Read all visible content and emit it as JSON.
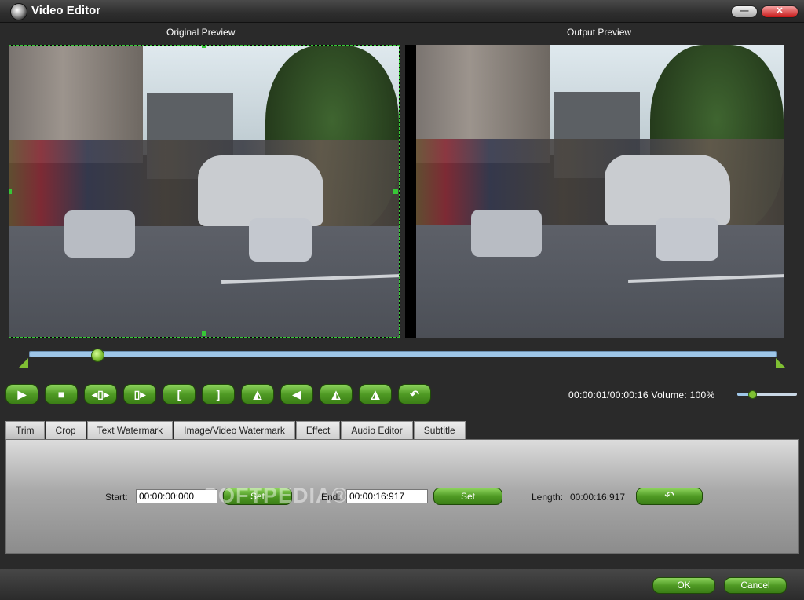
{
  "window": {
    "title": "Video Editor",
    "icon": "camera-icon"
  },
  "previews": {
    "original_label": "Original Preview",
    "output_label": "Output Preview"
  },
  "timeline": {
    "position_fraction": 0.09
  },
  "controls": {
    "buttons": [
      {
        "name": "play-button",
        "icon": "play-icon",
        "glyph": "▶"
      },
      {
        "name": "stop-button",
        "icon": "stop-icon",
        "glyph": "■"
      },
      {
        "name": "prev-frame-button",
        "icon": "previous-frame-icon",
        "glyph": "◂▯▸"
      },
      {
        "name": "next-frame-button",
        "icon": "next-frame-icon",
        "glyph": "▯▸"
      },
      {
        "name": "mark-in-button",
        "icon": "mark-in-bracket-icon",
        "glyph": "["
      },
      {
        "name": "mark-out-button",
        "icon": "mark-out-bracket-icon",
        "glyph": "]"
      },
      {
        "name": "flip-horizontal-button",
        "icon": "flip-horizontal-icon",
        "glyph": "◭"
      },
      {
        "name": "flip-vertical-button",
        "icon": "flip-vertical-icon",
        "glyph": "◀"
      },
      {
        "name": "rotate-left-button",
        "icon": "rotate-left-icon",
        "glyph": "◭"
      },
      {
        "name": "rotate-right-button",
        "icon": "rotate-right-icon",
        "glyph": "◮"
      },
      {
        "name": "undo-button",
        "icon": "undo-icon",
        "glyph": "↶"
      }
    ],
    "time_readout": "00:00:01/00:00:16",
    "volume_label": "Volume:",
    "volume_value": "100%",
    "volume_fraction": 0.25
  },
  "tabs": [
    {
      "label": "Trim",
      "active": true
    },
    {
      "label": "Crop",
      "active": false
    },
    {
      "label": "Text Watermark",
      "active": false
    },
    {
      "label": "Image/Video Watermark",
      "active": false
    },
    {
      "label": "Effect",
      "active": false
    },
    {
      "label": "Audio Editor",
      "active": false
    },
    {
      "label": "Subtitle",
      "active": false
    }
  ],
  "trim": {
    "start_label": "Start:",
    "start_value": "00:00:00:000",
    "end_label": "End:",
    "end_value": "00:00:16:917",
    "set_label": "Set",
    "length_label": "Length:",
    "length_value": "00:00:16:917",
    "reset_icon": "reset-icon"
  },
  "watermark_text": "SOFTPEDIA®",
  "dialog": {
    "ok_label": "OK",
    "cancel_label": "Cancel"
  },
  "colors": {
    "accent_green": "#5aa829",
    "timeline_blue": "#9ec6e8",
    "crop_border": "#37c837"
  }
}
